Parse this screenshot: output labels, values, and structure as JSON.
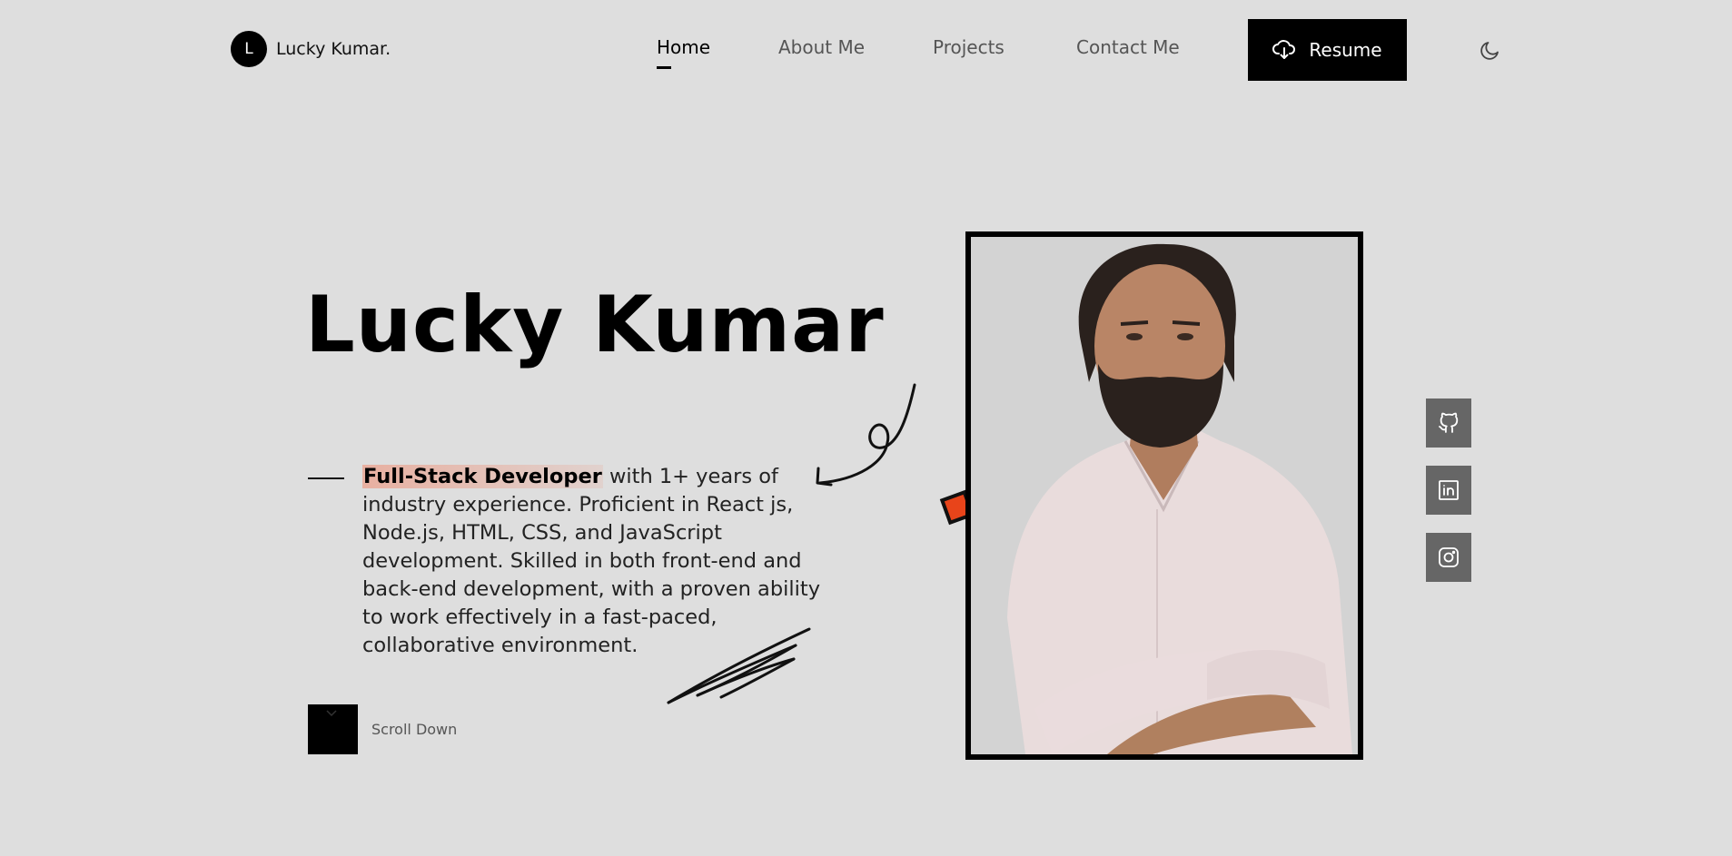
{
  "logo": {
    "initial": "L",
    "name": "Lucky Kumar."
  },
  "nav": {
    "items": [
      {
        "label": "Home",
        "active": true
      },
      {
        "label": "About Me",
        "active": false
      },
      {
        "label": "Projects",
        "active": false
      },
      {
        "label": "Contact Me",
        "active": false
      }
    ],
    "resume_label": "Resume"
  },
  "theme_toggle_icon": "moon-icon",
  "hero": {
    "title": "Lucky Kumar",
    "highlight": "Full-Stack Developer",
    "description": "with 1+ years of industry experience. Proficient in React js, Node.js, HTML, CSS, and JavaScript development. Skilled in both front-end and back-end development, with a proven ability to work effectively in a fast-paced, collaborative environment.",
    "scroll_label": "Scroll Down"
  },
  "social": [
    {
      "icon": "github-icon"
    },
    {
      "icon": "linkedin-icon"
    },
    {
      "icon": "instagram-icon"
    }
  ],
  "colors": {
    "background": "#dedede",
    "accent": "#e8441a",
    "highlight": "#eba08c",
    "social_bg": "#666666"
  }
}
